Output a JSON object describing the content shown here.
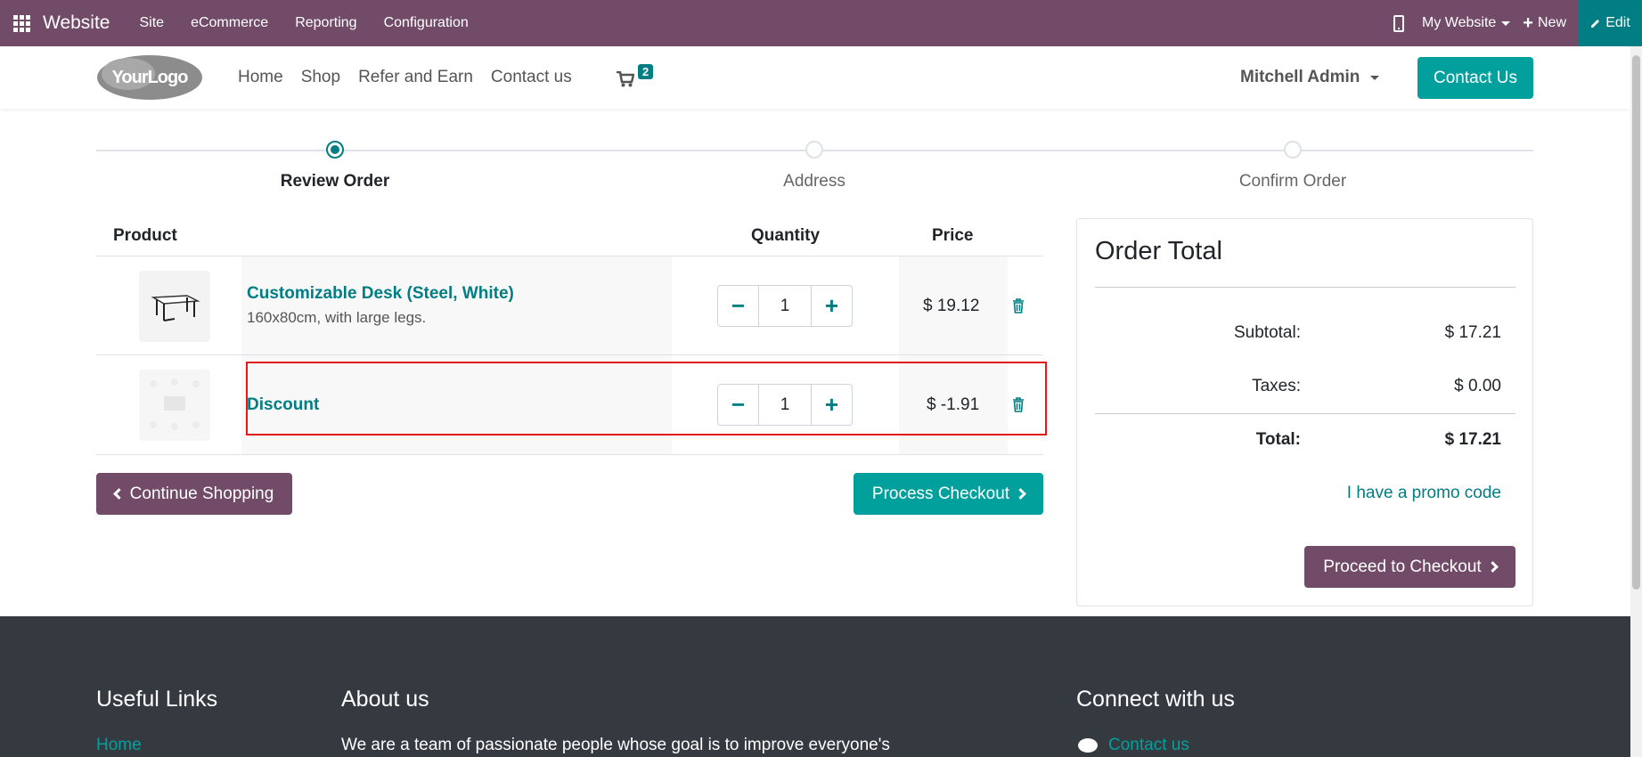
{
  "topbar": {
    "app_title": "Website",
    "menu": [
      "Site",
      "eCommerce",
      "Reporting",
      "Configuration"
    ],
    "website_selector": "My Website",
    "new_label": "New",
    "edit_label": "Edit",
    "color": "#714B67",
    "edit_color": "#017E84"
  },
  "header": {
    "logo_text": "YourLogo",
    "nav": [
      "Home",
      "Shop",
      "Refer and Earn",
      "Contact us"
    ],
    "cart_count": "2",
    "user": "Mitchell Admin",
    "contact_button": "Contact Us"
  },
  "wizard": {
    "steps": [
      {
        "label": "Review Order",
        "active": true
      },
      {
        "label": "Address",
        "active": false
      },
      {
        "label": "Confirm Order",
        "active": false
      }
    ]
  },
  "cart": {
    "columns": {
      "product": "Product",
      "quantity": "Quantity",
      "price": "Price"
    },
    "lines": [
      {
        "name": "Customizable Desk (Steel, White)",
        "description": "160x80cm, with large legs.",
        "quantity": "1",
        "price": "$ 19.12",
        "image": "desk-image"
      },
      {
        "name": "Discount",
        "description": "",
        "quantity": "1",
        "price": "$ -1.91",
        "image": "discount-image"
      }
    ],
    "continue_label": "Continue Shopping",
    "process_label": "Process Checkout"
  },
  "order_total": {
    "title": "Order Total",
    "subtotal_label": "Subtotal:",
    "subtotal": "$ 17.21",
    "taxes_label": "Taxes:",
    "taxes": "$ 0.00",
    "total_label": "Total:",
    "total": "$ 17.21",
    "promo_link": "I have a promo code",
    "proceed_label": "Proceed to Checkout"
  },
  "footer": {
    "useful_links_title": "Useful Links",
    "useful_links_first": "Home",
    "about_title": "About us",
    "about_text": "We are a team of passionate people whose goal is to improve everyone's",
    "connect_title": "Connect with us",
    "connect_link": "Contact us"
  }
}
